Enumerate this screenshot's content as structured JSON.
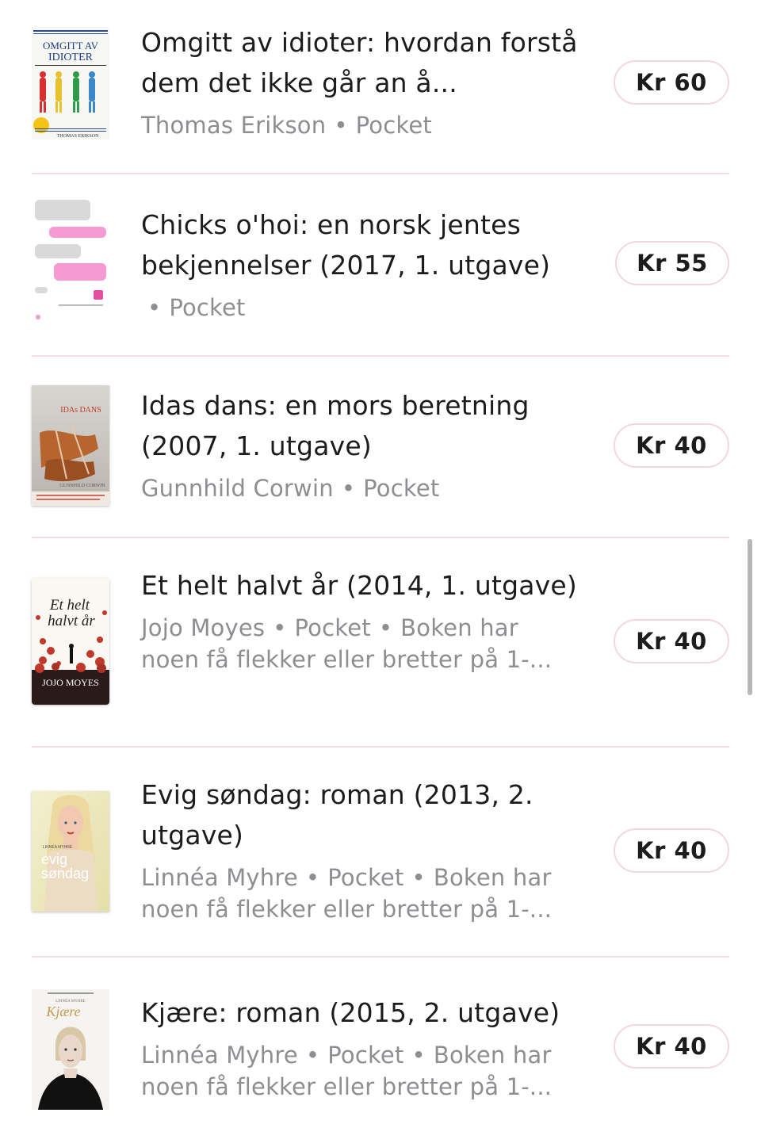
{
  "items": [
    {
      "title": "Omgitt av idioter: hvordan forstå dem det ikke går an å...",
      "meta": [
        "Thomas Erikson",
        "Pocket"
      ],
      "price": "Kr 60",
      "cover": {
        "headline": "OMGITT AV IDIOTER",
        "author": "THOMAS ERIKSON"
      }
    },
    {
      "title": "Chicks o'hoi: en norsk jentes bekjennelser (2017, 1. utgave)",
      "meta": [
        "",
        "Pocket"
      ],
      "price": "Kr 55",
      "cover": {}
    },
    {
      "title": "Idas dans: en mors beretning (2007, 1. utgave)",
      "meta": [
        "Gunnhild Corwin",
        "Pocket"
      ],
      "price": "Kr 40",
      "cover": {
        "headline": "IDAs DANS",
        "author": "GUNNHILD CORWIN"
      }
    },
    {
      "title": "Et helt halvt år (2014, 1. utgave)",
      "meta": [
        "Jojo Moyes",
        "Pocket",
        "Boken har noen få flekker eller bretter på 1-..."
      ],
      "price": "Kr 40",
      "cover": {
        "headline": "Et helt halvt år",
        "author": "JOJO MOYES"
      }
    },
    {
      "title": "Evig søndag: roman (2013, 2. utgave)",
      "meta": [
        "Linnéa Myhre",
        "Pocket",
        "Boken har noen få flekker eller bretter på 1-..."
      ],
      "price": "Kr 40",
      "cover": {
        "headline": "evig søndag",
        "author": "LINNÉA MYHRE"
      }
    },
    {
      "title": "Kjære: roman (2015, 2. utgave)",
      "meta": [
        "Linnéa Myhre",
        "Pocket",
        "Boken har noen få flekker eller bretter på 1-..."
      ],
      "price": "Kr 40",
      "cover": {
        "headline": "Kjære",
        "author": "LINNÉA MYHRE"
      }
    }
  ],
  "colors": {
    "divider": "#f6dde2",
    "price_border": "#f4d7dd",
    "meta_text": "#8d8d92",
    "title_text": "#1c1c1c"
  }
}
